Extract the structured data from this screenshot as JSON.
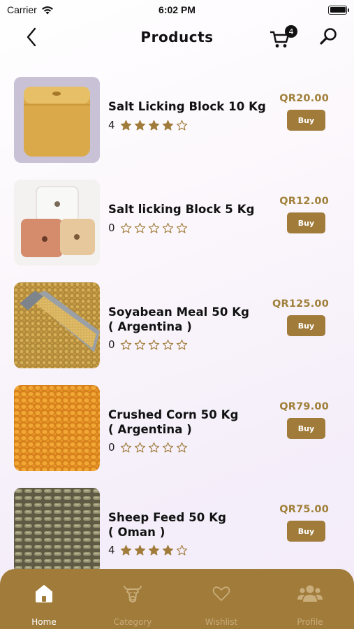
{
  "status": {
    "carrier": "Carrier",
    "time": "6:02 PM"
  },
  "header": {
    "title": "Products",
    "cart_count": "4"
  },
  "products": [
    {
      "name": "Salt Licking Block 10 Kg",
      "rating": "4",
      "stars": 4,
      "price": "QR20.00",
      "buy": "Buy"
    },
    {
      "name": "Salt licking Block 5 Kg",
      "rating": "0",
      "stars": 0,
      "price": "QR12.00",
      "buy": "Buy"
    },
    {
      "name": "Soyabean Meal 50 Kg\n( Argentina )",
      "rating": "0",
      "stars": 0,
      "price": "QR125.00",
      "buy": "Buy"
    },
    {
      "name": "Crushed Corn 50 Kg\n( Argentina )",
      "rating": "0",
      "stars": 0,
      "price": "QR79.00",
      "buy": "Buy"
    },
    {
      "name": "Sheep Feed  50 Kg\n( Oman )",
      "rating": "4",
      "stars": 4,
      "price": "QR75.00",
      "buy": "Buy"
    }
  ],
  "tabs": [
    {
      "label": "Home",
      "icon": "home-icon",
      "active": true
    },
    {
      "label": "Category",
      "icon": "cow-icon",
      "active": false
    },
    {
      "label": "Wishlist",
      "icon": "heart-icon",
      "active": false
    },
    {
      "label": "Profile",
      "icon": "people-icon",
      "active": false
    }
  ],
  "colors": {
    "accent": "#a07b3a",
    "price": "#a0803a"
  }
}
